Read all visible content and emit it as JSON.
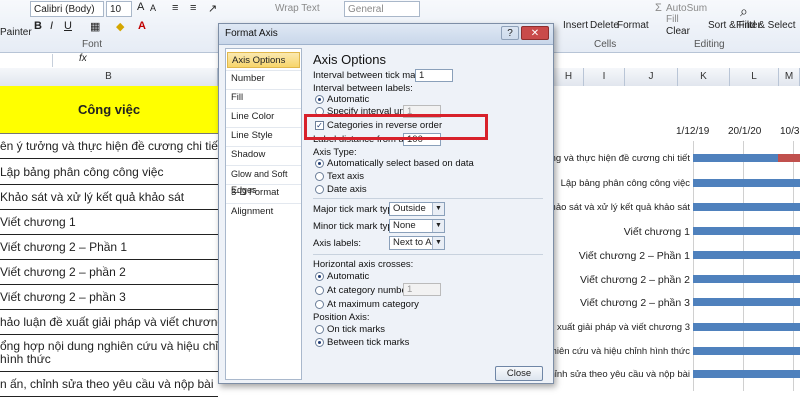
{
  "ribbon": {
    "painter_label": "Painter",
    "font_name": "Calibri (Body)",
    "font_size": "10",
    "font_group": "Font",
    "wrap_text": "Wrap Text",
    "number_format": "General",
    "insert_label": "Insert",
    "delete_label": "Delete",
    "format_label": "Format",
    "cells_group": "Cells",
    "autosum_label": "AutoSum",
    "fill_label": "Fill",
    "clear_label": "Clear",
    "sort_filter_label": "Sort & Filter",
    "find_select_label": "Find & Select",
    "editing_group": "Editing",
    "fx_label": "fx"
  },
  "columns": {
    "left": [
      "B"
    ],
    "right": [
      "H",
      "I",
      "J",
      "K",
      "L",
      "M"
    ]
  },
  "sheet": {
    "header": "Công việc",
    "rows": [
      "ên ý tưởng và thực hiện đề cương chi tiết",
      "Lập bảng phân công công việc",
      "Khảo sát và xử lý kết quả khảo sát",
      "Viết chương 1",
      "Viết chương 2 – Phần 1",
      "Viết chương 2 – phần 2",
      "Viết chương 2 – phần 3",
      "hảo luận đề xuất giải pháp và viết chương 3",
      "ổng hợp nội dung nghiên cứu và hiệu chỉnh",
      "hình thức",
      "n ấn, chỉnh sửa theo yêu cầu và nộp bài"
    ]
  },
  "chart": {
    "dates": [
      "1/12/19",
      "20/1/20",
      "10/3"
    ],
    "labels": [
      "ng và thực hiện đề cương chi tiết",
      "Lập bảng phân công công việc",
      "Khảo sát và xử lý kết quả khảo sát",
      "Viết chương 1",
      "Viết chương 2 – Phần 1",
      "Viết chương 2 – phần 2",
      "Viết chương 2 – phần 3",
      "xuất giải pháp và viết chương 3",
      "nghiên cứu và hiệu chỉnh hình thức",
      "chỉnh sửa theo yêu cầu và nộp bài"
    ]
  },
  "dialog": {
    "title": "Format Axis",
    "help": "?",
    "close_x": "✕",
    "nav": [
      "Axis Options",
      "Number",
      "Fill",
      "Line Color",
      "Line Style",
      "Shadow",
      "Glow and Soft Edges",
      "3-D Format",
      "Alignment"
    ],
    "panel_title": "Axis Options",
    "interval_tick_label": "Interval between tick marks:",
    "interval_tick_value": "1",
    "interval_labels_label": "Interval between labels:",
    "automatic": "Automatic",
    "specify_interval": "Specify interval unit:",
    "specify_value": "1",
    "reverse_order": "Categories in reverse order",
    "label_distance": "Label distance from axis:",
    "label_distance_value": "100",
    "axis_type_label": "Axis Type:",
    "auto_select": "Automatically select based on data",
    "text_axis": "Text axis",
    "date_axis": "Date axis",
    "major_tick_label": "Major tick mark type:",
    "major_tick_value": "Outside",
    "minor_tick_label": "Minor tick mark type:",
    "minor_tick_value": "None",
    "axis_labels_label": "Axis labels:",
    "axis_labels_value": "Next to Axis",
    "h_axis_crosses": "Horizontal axis crosses:",
    "crosses_auto": "Automatic",
    "at_category": "At category number:",
    "at_category_value": "1",
    "at_max": "At maximum category",
    "position_axis": "Position Axis:",
    "on_tick": "On tick marks",
    "between_tick": "Between tick marks",
    "close_button": "Close"
  },
  "colors": {
    "bar": "#4f81bd",
    "highlight": "#d8212b",
    "header_fill": "#ffff00"
  }
}
